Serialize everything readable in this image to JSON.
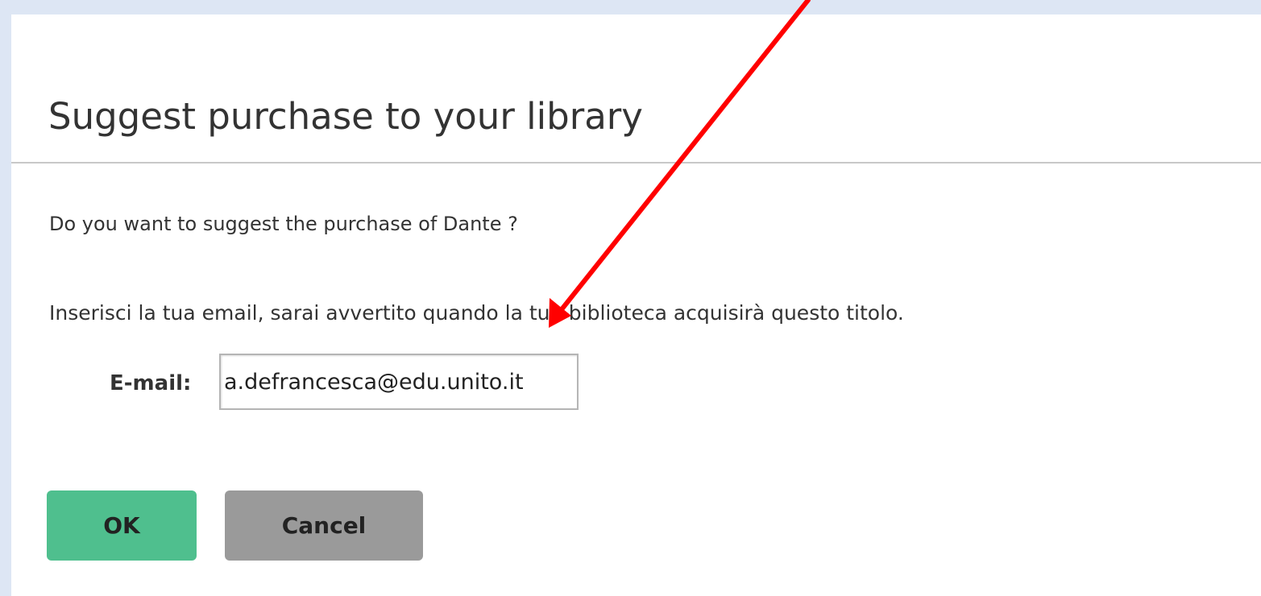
{
  "dialog": {
    "title": "Suggest purchase to your library",
    "question": "Do you want to suggest the purchase of Dante ?",
    "info": "Inserisci la tua email, sarai avvertito quando la tua biblioteca acquisirà questo titolo.",
    "email_label": "E-mail:",
    "email_value": "a.defrancesca@edu.unito.it",
    "ok_label": "OK",
    "cancel_label": "Cancel"
  },
  "colors": {
    "page_background": "#dde6f4",
    "ok_button": "#4fbf8e",
    "cancel_button": "#9a9a9a",
    "annotation_arrow": "#ff0000"
  },
  "annotation": {
    "icon": "arrow-icon"
  }
}
